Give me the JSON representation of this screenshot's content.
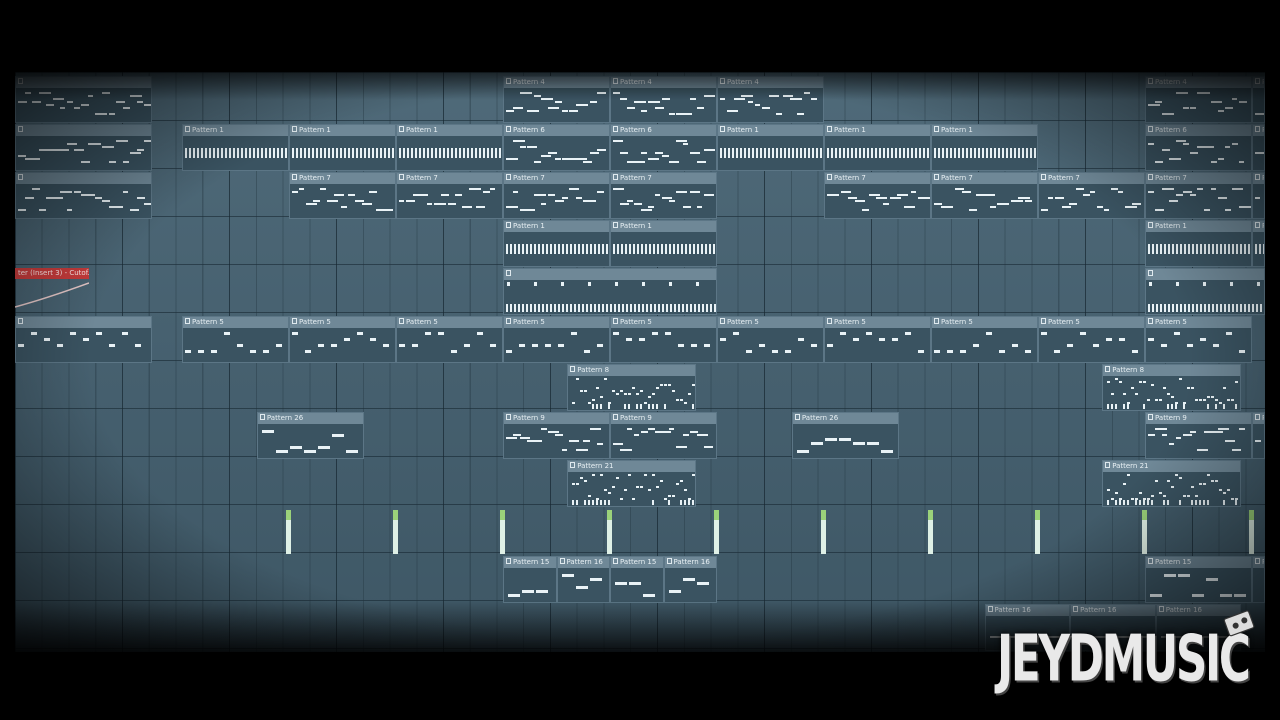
{
  "window": {
    "type": "fl-studio-playlist",
    "accent_color": "#47606e",
    "clip_header_color": "#6f8897"
  },
  "automation_clip": {
    "label": "ter (Insert 3) - Cutof...",
    "color": "#c83c3c"
  },
  "watermark": {
    "text": "JEYDMUSIC"
  },
  "tracks": [
    {
      "name": "track-1",
      "clips": [
        {
          "label": "",
          "start": 0,
          "len": 1
        },
        {
          "label": "Pattern 4",
          "start": 4,
          "len": 1
        },
        {
          "label": "Pattern 4",
          "start": 5,
          "len": 1
        },
        {
          "label": "Pattern 4",
          "start": 6,
          "len": 1
        },
        {
          "label": "Pattern 4",
          "start": 10,
          "len": 1
        },
        {
          "label": "Pattern 4",
          "start": 11,
          "len": 1
        },
        {
          "label": "Pattern 4",
          "start": 12,
          "len": 1
        },
        {
          "label": "Pattern 4",
          "start": 13,
          "len": 1
        }
      ]
    },
    {
      "name": "track-2",
      "clips": [
        {
          "label": "",
          "start": 0,
          "len": 1
        },
        {
          "label": "Pattern 1",
          "start": 1,
          "len": 1,
          "style": "ticks"
        },
        {
          "label": "Pattern 1",
          "start": 2,
          "len": 1,
          "style": "ticks"
        },
        {
          "label": "Pattern 1",
          "start": 3,
          "len": 1,
          "style": "ticks"
        },
        {
          "label": "Pattern 6",
          "start": 4,
          "len": 1,
          "style": "melody"
        },
        {
          "label": "Pattern 6",
          "start": 5,
          "len": 1,
          "style": "melody"
        },
        {
          "label": "Pattern 1",
          "start": 6,
          "len": 1,
          "style": "ticks"
        },
        {
          "label": "Pattern 1",
          "start": 7,
          "len": 1,
          "style": "ticks"
        },
        {
          "label": "Pattern 1",
          "start": 8,
          "len": 1,
          "style": "ticks"
        },
        {
          "label": "Pattern 6",
          "start": 10,
          "len": 1,
          "style": "melody"
        },
        {
          "label": "Pattern 6",
          "start": 11,
          "len": 1,
          "style": "melody"
        },
        {
          "label": "Pattern 6",
          "start": 12,
          "len": 1,
          "style": "melody"
        }
      ]
    },
    {
      "name": "track-3",
      "clips": [
        {
          "label": "",
          "start": 0,
          "len": 1,
          "style": "melody"
        },
        {
          "label": "Pattern 7",
          "start": 2,
          "len": 1,
          "style": "melody"
        },
        {
          "label": "Pattern 7",
          "start": 3,
          "len": 1,
          "style": "melody"
        },
        {
          "label": "Pattern 7",
          "start": 4,
          "len": 1,
          "style": "melody"
        },
        {
          "label": "Pattern 7",
          "start": 5,
          "len": 1,
          "style": "melody"
        },
        {
          "label": "Pattern 7",
          "start": 7,
          "len": 1,
          "style": "melody"
        },
        {
          "label": "Pattern 7",
          "start": 8,
          "len": 1,
          "style": "melody"
        },
        {
          "label": "Pattern 7",
          "start": 9,
          "len": 1,
          "style": "melody"
        },
        {
          "label": "Pattern 7",
          "start": 10,
          "len": 1,
          "style": "melody"
        },
        {
          "label": "Pattern 7",
          "start": 11,
          "len": 1,
          "style": "melody"
        }
      ]
    },
    {
      "name": "track-4",
      "clips": [
        {
          "label": "Pattern 1",
          "start": 4,
          "len": 1,
          "style": "ticks"
        },
        {
          "label": "Pattern 1",
          "start": 5,
          "len": 1,
          "style": "ticks"
        },
        {
          "label": "Pattern 1",
          "start": 10,
          "len": 1,
          "style": "ticks"
        },
        {
          "label": "Pattern 1",
          "start": 11,
          "len": 1,
          "style": "ticks"
        }
      ]
    },
    {
      "name": "track-5",
      "clips": [
        {
          "label": "",
          "start": 4,
          "len": 2,
          "style": "ticks2"
        },
        {
          "label": "",
          "start": 10,
          "len": 2,
          "style": "ticks2"
        }
      ]
    },
    {
      "name": "track-6",
      "clips": [
        {
          "label": "",
          "start": 0,
          "len": 1,
          "style": "dots"
        },
        {
          "label": "Pattern 5",
          "start": 1,
          "len": 1,
          "style": "dots"
        },
        {
          "label": "Pattern 5",
          "start": 2,
          "len": 1,
          "style": "dots"
        },
        {
          "label": "Pattern 5",
          "start": 3,
          "len": 1,
          "style": "dots"
        },
        {
          "label": "Pattern 5",
          "start": 4,
          "len": 1,
          "style": "dots"
        },
        {
          "label": "Pattern 5",
          "start": 5,
          "len": 1,
          "style": "dots"
        },
        {
          "label": "Pattern 5",
          "start": 6,
          "len": 1,
          "style": "dots"
        },
        {
          "label": "Pattern 5",
          "start": 7,
          "len": 1,
          "style": "dots"
        },
        {
          "label": "Pattern 5",
          "start": 8,
          "len": 1,
          "style": "dots"
        },
        {
          "label": "Pattern 5",
          "start": 9,
          "len": 1,
          "style": "dots"
        },
        {
          "label": "Pattern 5",
          "start": 10,
          "len": 1,
          "style": "dots"
        }
      ]
    },
    {
      "name": "track-7",
      "clips": [
        {
          "label": "Pattern 8",
          "start": 4.6,
          "len": 1.2,
          "style": "dense"
        },
        {
          "label": "Pattern 8",
          "start": 9.6,
          "len": 1.3,
          "style": "dense"
        }
      ]
    },
    {
      "name": "track-8",
      "clips": [
        {
          "label": "Pattern 26",
          "start": 1.7,
          "len": 1,
          "style": "stairs"
        },
        {
          "label": "Pattern 9",
          "start": 4,
          "len": 1,
          "style": "melody"
        },
        {
          "label": "Pattern 9",
          "start": 5,
          "len": 1,
          "style": "melody"
        },
        {
          "label": "Pattern 26",
          "start": 6.7,
          "len": 1,
          "style": "stairs"
        },
        {
          "label": "Pattern 9",
          "start": 10,
          "len": 1,
          "style": "melody"
        },
        {
          "label": "Pattern 9",
          "start": 11,
          "len": 1,
          "style": "melody"
        },
        {
          "label": "Pattern 9",
          "start": 12,
          "len": 1,
          "style": "melody"
        }
      ]
    },
    {
      "name": "track-9",
      "clips": [
        {
          "label": "Pattern 21",
          "start": 4.6,
          "len": 1.2,
          "style": "dense"
        },
        {
          "label": "Pattern 21",
          "start": 9.6,
          "len": 1.3,
          "style": "dense"
        }
      ]
    },
    {
      "name": "track-10",
      "clips": []
    },
    {
      "name": "track-11",
      "clips": [
        {
          "label": "Pattern 15",
          "start": 4,
          "len": 0.5,
          "style": "stairs"
        },
        {
          "label": "Pattern 16",
          "start": 4.5,
          "len": 0.5,
          "style": "stairs"
        },
        {
          "label": "Pattern 15",
          "start": 5,
          "len": 0.5,
          "style": "stairs"
        },
        {
          "label": "Pattern 16",
          "start": 5.5,
          "len": 0.5,
          "style": "stairs"
        },
        {
          "label": "Pattern 15",
          "start": 10,
          "len": 1,
          "style": "stairs"
        },
        {
          "label": "Pattern 15",
          "start": 11,
          "len": 1,
          "style": "stairs"
        },
        {
          "label": "Pattern 15",
          "start": 12,
          "len": 1,
          "style": "stairs"
        }
      ]
    },
    {
      "name": "track-12",
      "clips": [
        {
          "label": "Pattern 16",
          "start": 8.5,
          "len": 0.8,
          "style": "long"
        },
        {
          "label": "Pattern 16",
          "start": 9.3,
          "len": 0.8,
          "style": "long"
        },
        {
          "label": "Pattern 16",
          "start": 10.1,
          "len": 0.8,
          "style": "long"
        }
      ]
    }
  ]
}
